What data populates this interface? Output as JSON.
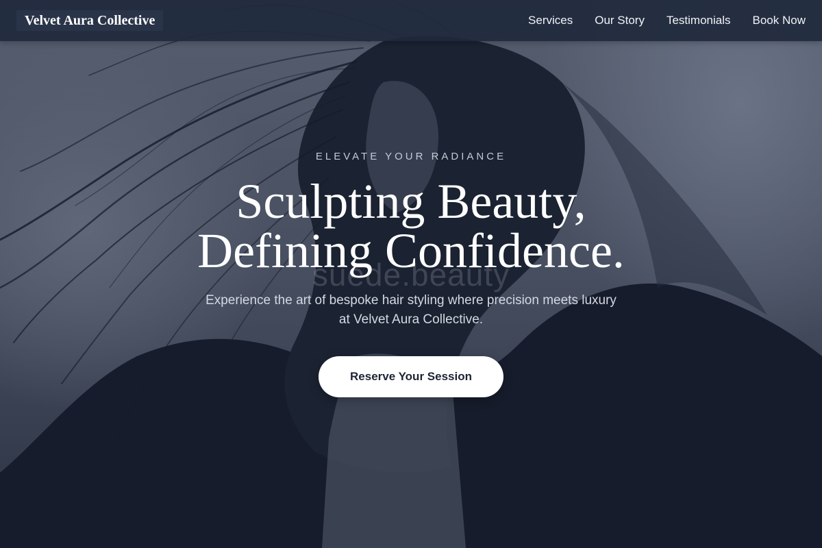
{
  "brand": {
    "name": "Velvet Aura Collective"
  },
  "nav": {
    "items": [
      {
        "label": "Services"
      },
      {
        "label": "Our Story"
      },
      {
        "label": "Testimonials"
      },
      {
        "label": "Book Now"
      }
    ]
  },
  "hero": {
    "eyebrow": "ELEVATE YOUR RADIANCE",
    "headline_line1": "Sculpting Beauty,",
    "headline_line2": "Defining Confidence.",
    "watermark": "suede.beauty",
    "subtitle": "Experience the art of bespoke hair styling where precision meets luxury at Velvet Aura Collective.",
    "cta_label": "Reserve Your Session",
    "background_image": "woman-with-windblown-hair-photo"
  },
  "colors": {
    "navbar_bg": "#1f293c",
    "hero_overlay": "#2a3142",
    "cta_bg": "#ffffff",
    "cta_text": "#1d2434",
    "text_primary": "#ffffff",
    "text_muted": "#c5cbd6"
  }
}
